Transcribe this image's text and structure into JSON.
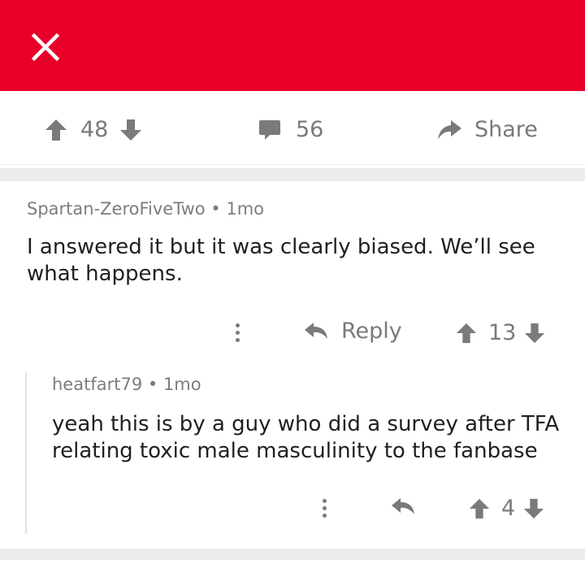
{
  "header": {
    "close_icon": "close-icon",
    "bar_color": "#e8002a"
  },
  "post_actions": {
    "score": "48",
    "comments": "56",
    "share_label": "Share"
  },
  "comments": [
    {
      "author": "Spartan-ZeroFiveTwo",
      "age": "1mo",
      "body_lines": [
        "I answered it but it was clearly biased. We’ll see",
        "what happens."
      ],
      "reply_label": "Reply",
      "score": "13"
    },
    {
      "author": "heatfart79",
      "age": "1mo",
      "body_lines": [
        "yeah this is by a guy who did a survey after TFA",
        "relating toxic male masculinity to the fanbase"
      ],
      "score": "4"
    }
  ]
}
